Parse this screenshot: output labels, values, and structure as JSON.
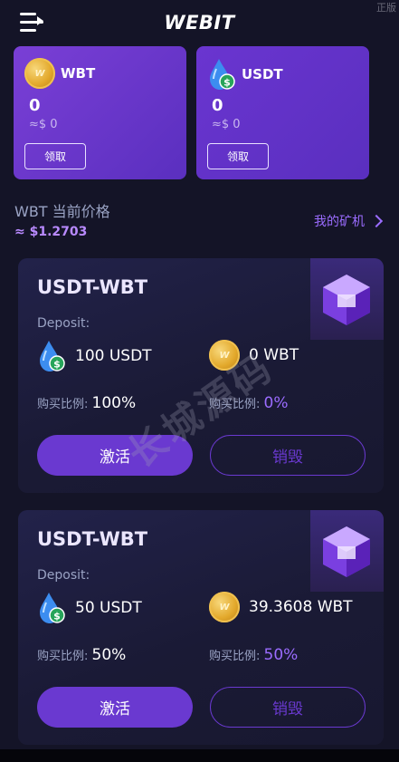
{
  "version_tag": "正版",
  "header": {
    "title": "WEBIT"
  },
  "wallets": [
    {
      "name": "WBT",
      "amount": "0",
      "usd": "≈$ 0",
      "claim_label": "领取"
    },
    {
      "name": "USDT",
      "amount": "0",
      "usd": "≈$ 0",
      "claim_label": "领取"
    }
  ],
  "price": {
    "label": "WBT 当前价格",
    "value": "≈ $1.2703",
    "mine_link": "我的矿机"
  },
  "cards": [
    {
      "pair": "USDT-WBT",
      "deposit_label": "Deposit:",
      "asset1": "100 USDT",
      "asset2": "0 WBT",
      "ratio_label": "购买比例:",
      "ratio1": "100%",
      "ratio2": "0%",
      "activate_label": "激活",
      "destroy_label": "销毁"
    },
    {
      "pair": "USDT-WBT",
      "deposit_label": "Deposit:",
      "asset1": "50 USDT",
      "asset2": "39.3608 WBT",
      "ratio_label": "购买比例:",
      "ratio1": "50%",
      "ratio2": "50%",
      "activate_label": "激活",
      "destroy_label": "销毁"
    }
  ],
  "watermark": "长城源码",
  "icons": {
    "menu": "menu-icon",
    "wbt": "wbt-coin-icon",
    "usdt": "usdt-drop-icon",
    "mining_box": "mining-box-icon",
    "chevron": "chevron-right-icon"
  }
}
